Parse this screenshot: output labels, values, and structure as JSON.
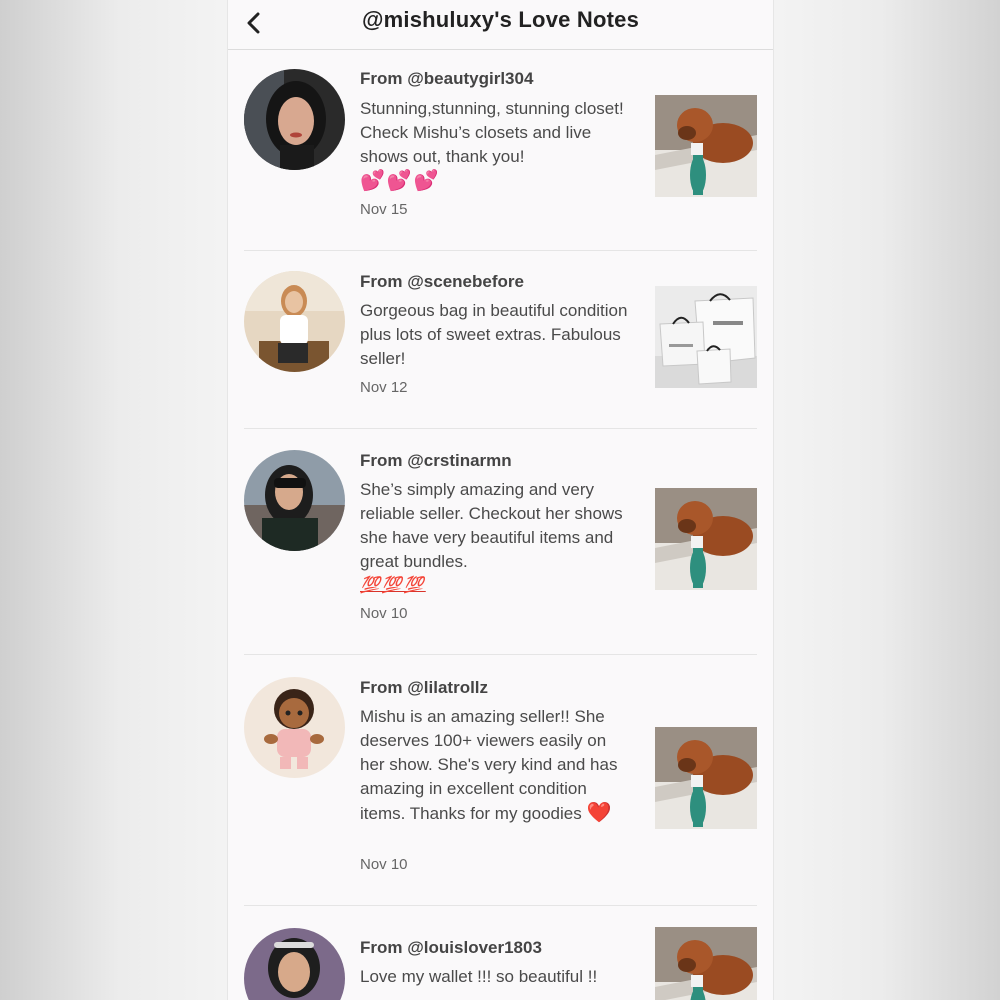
{
  "header": {
    "title": "@mishuluxy's Love Notes",
    "back_icon": "chevron-left-icon"
  },
  "notes": [
    {
      "from": "From @beautygirl304",
      "message": "Stunning,stunning, stunning closet! Check Mishu’s closets and live shows out, thank you!",
      "emoji": "💕💕💕",
      "date": "Nov 15",
      "thumbnail": "dog-photo"
    },
    {
      "from": "From @scenebefore",
      "message": "Gorgeous bag in beautiful condition plus lots of sweet extras. Fabulous seller!",
      "emoji": "",
      "date": "Nov 12",
      "thumbnail": "shopping-bags-photo"
    },
    {
      "from": "From @crstinarmn",
      "message": "She’s simply amazing and very reliable seller. Checkout her shows she have very beautiful items and great bundles.",
      "emoji": "💯💯💯",
      "date": "Nov 10",
      "thumbnail": "dog-photo"
    },
    {
      "from": "From @lilatrollz",
      "message": "Mishu is an amazing seller!! She deserves 100+ viewers easily on her show. She's very kind and has amazing in excellent condition items. Thanks for my goodies",
      "emoji": "❤️",
      "date": "Nov 10",
      "thumbnail": "dog-photo"
    },
    {
      "from": "From @louislover1803",
      "message": "Love my wallet !!! so beautiful !!",
      "emoji": "",
      "date": "",
      "thumbnail": "dog-photo"
    }
  ]
}
